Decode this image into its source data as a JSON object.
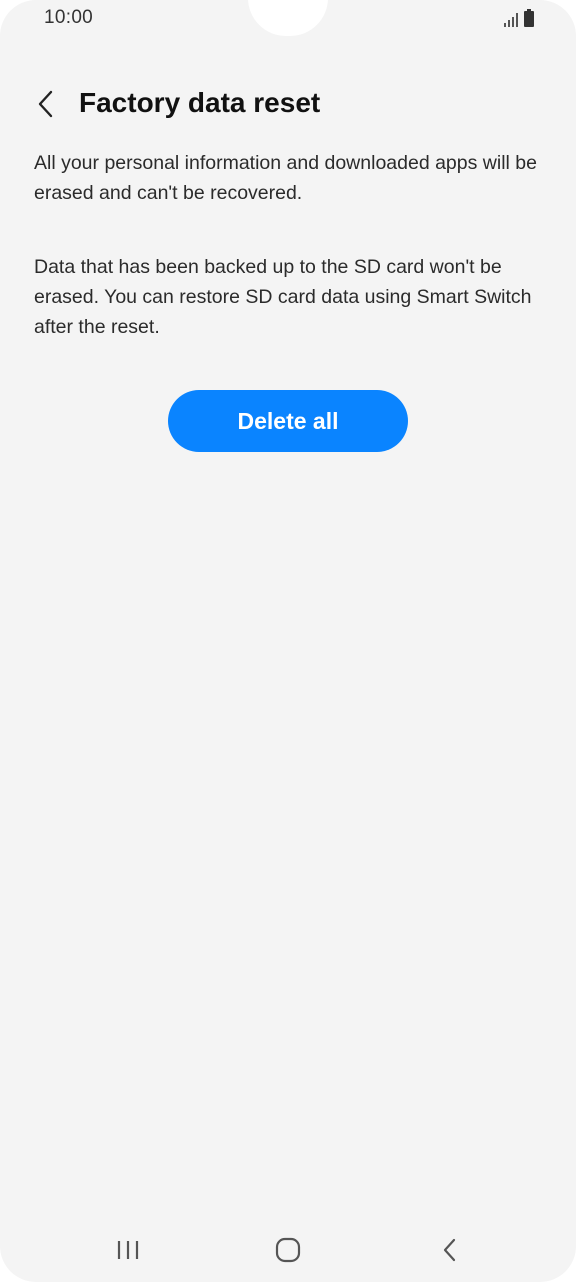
{
  "status_bar": {
    "time": "10:00",
    "signal_icon": "signal-icon",
    "battery_icon": "battery-icon"
  },
  "header": {
    "back_icon": "chevron-left-icon",
    "title": "Factory data reset"
  },
  "content": {
    "paragraph_1": "All your personal information and downloaded apps will be erased and can't be recovered.",
    "paragraph_2": "Data that has been backed up to the SD card won't be erased. You can restore SD card data using Smart Switch after the reset.",
    "delete_button_label": "Delete all"
  },
  "nav_bar": {
    "recents_icon": "recents-icon",
    "home_icon": "home-icon",
    "back_icon": "back-icon"
  },
  "colors": {
    "accent": "#0a84ff",
    "background": "#f4f4f4",
    "text": "#2b2b2b"
  }
}
